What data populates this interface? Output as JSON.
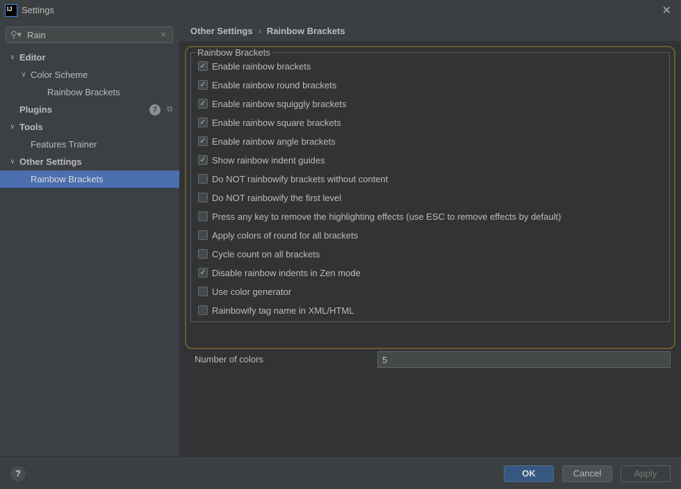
{
  "window": {
    "title": "Settings",
    "logo": "IJ"
  },
  "search": {
    "value": "Rain"
  },
  "sidebar": {
    "items": [
      {
        "label": "Editor",
        "level": 0,
        "expanded": true,
        "bold": true
      },
      {
        "label": "Color Scheme",
        "level": 1,
        "expanded": true,
        "bold": false
      },
      {
        "label": "Rainbow Brackets",
        "level": 2,
        "bold": false
      },
      {
        "label": "Plugins",
        "level": 0,
        "bold": true,
        "badge": "7"
      },
      {
        "label": "Tools",
        "level": 0,
        "expanded": true,
        "bold": true
      },
      {
        "label": "Features Trainer",
        "level": 1,
        "bold": false
      },
      {
        "label": "Other Settings",
        "level": 0,
        "expanded": true,
        "bold": true
      },
      {
        "label": "Rainbow Brackets",
        "level": 1,
        "bold": false,
        "selected": true
      }
    ]
  },
  "breadcrumb": {
    "parent": "Other Settings",
    "current": "Rainbow Brackets"
  },
  "group": {
    "title": "Rainbow Brackets",
    "options": [
      {
        "label": "Enable rainbow brackets",
        "checked": true
      },
      {
        "label": "Enable rainbow round brackets",
        "checked": true
      },
      {
        "label": "Enable rainbow squiggly brackets",
        "checked": true
      },
      {
        "label": "Enable rainbow square brackets",
        "checked": true
      },
      {
        "label": "Enable rainbow angle brackets",
        "checked": true
      },
      {
        "label": "Show rainbow indent guides",
        "checked": true
      },
      {
        "label": "Do NOT rainbowify brackets without content",
        "checked": false
      },
      {
        "label": "Do NOT rainbowify the first level",
        "checked": false
      },
      {
        "label": "Press any key to remove the highlighting effects (use ESC to remove effects by default)",
        "checked": false
      },
      {
        "label": "Apply colors of round for all brackets",
        "checked": false
      },
      {
        "label": "Cycle count on all brackets",
        "checked": false
      },
      {
        "label": "Disable rainbow indents in Zen mode",
        "checked": true
      },
      {
        "label": "Use color generator",
        "checked": false
      },
      {
        "label": "Rainbowify tag name in XML/HTML",
        "checked": false
      }
    ],
    "number_of_colors": {
      "label": "Number of colors",
      "value": "5"
    }
  },
  "buttons": {
    "help": "?",
    "ok": "OK",
    "cancel": "Cancel",
    "apply": "Apply"
  },
  "colors": {
    "selection": "#4b6eaf",
    "ok_button": "#365880",
    "highlight_border": "#6b5a2a"
  }
}
